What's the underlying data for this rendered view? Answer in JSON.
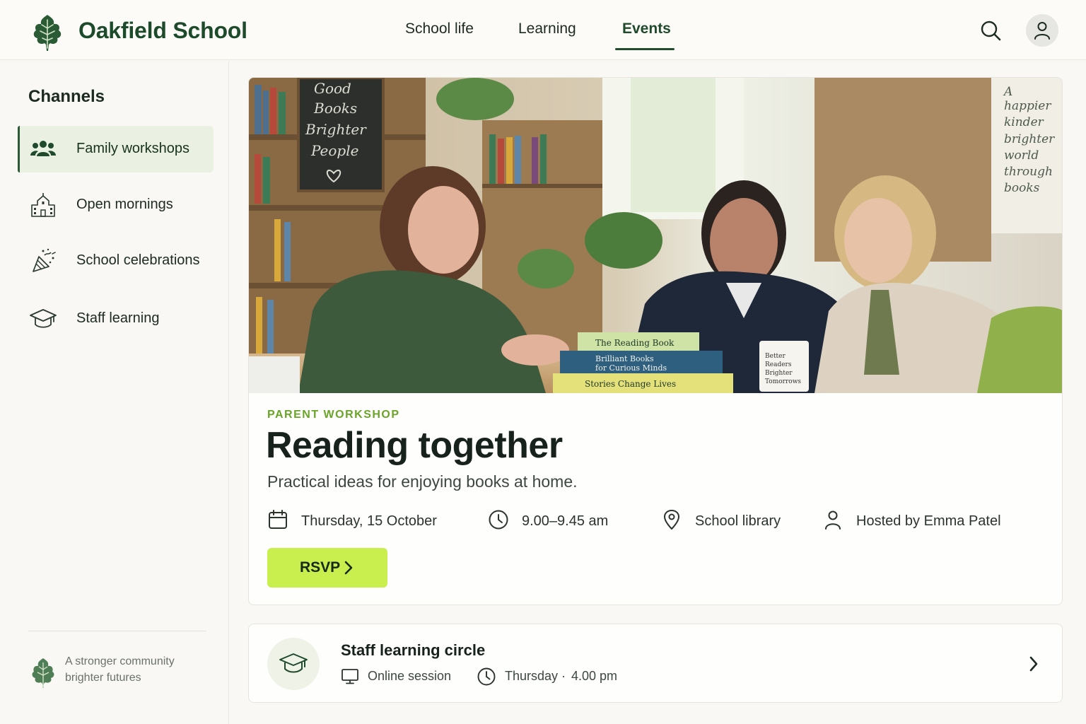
{
  "brand": {
    "name": "Oakfield School",
    "logo_icon": "oak-leaf-icon",
    "color": "#1d4a2b"
  },
  "nav": {
    "items": [
      {
        "label": "School life",
        "active": false
      },
      {
        "label": "Learning",
        "active": false
      },
      {
        "label": "Events",
        "active": true
      }
    ],
    "search_icon": "search-icon",
    "account_icon": "user-icon"
  },
  "sidebar": {
    "title": "Channels",
    "items": [
      {
        "label": "Family workshops",
        "icon": "people-icon",
        "active": true
      },
      {
        "label": "Open mornings",
        "icon": "school-building-icon",
        "active": false
      },
      {
        "label": "School celebrations",
        "icon": "party-popper-icon",
        "active": false
      },
      {
        "label": "Staff learning",
        "icon": "graduation-cap-icon",
        "active": false
      }
    ],
    "tagline": {
      "line1": "A stronger community",
      "line2": "brighter futures"
    }
  },
  "event": {
    "eyebrow": "PARENT WORKSHOP",
    "title": "Reading together",
    "subtitle": "Practical ideas for enjoying books at home.",
    "hero_image": {
      "description_icon": "library-photo",
      "chalkboard_text": [
        "Good",
        "Books",
        "Brighter",
        "People"
      ],
      "poster_text": [
        "A",
        "happier",
        "kinder",
        "brighter",
        "world",
        "through",
        "books"
      ],
      "book_titles": [
        "The Reading Book",
        "Brilliant Books",
        "for Curious Minds",
        "Stories Change Lives"
      ],
      "mug_text": [
        "Better",
        "Readers",
        "Brighter",
        "Tomorrows"
      ]
    },
    "meta": {
      "date": "Thursday, 15 October",
      "time": "9.00–9.45 am",
      "location": "School library",
      "host": "Hosted by Emma Patel"
    },
    "rsvp_label": "RSVP",
    "accent": "#6aa428",
    "button_color": "#c8ef4e"
  },
  "next_event": {
    "title": "Staff learning circle",
    "mode": "Online session",
    "day": "Thursday",
    "separator": "·",
    "time": "4.00 pm"
  }
}
